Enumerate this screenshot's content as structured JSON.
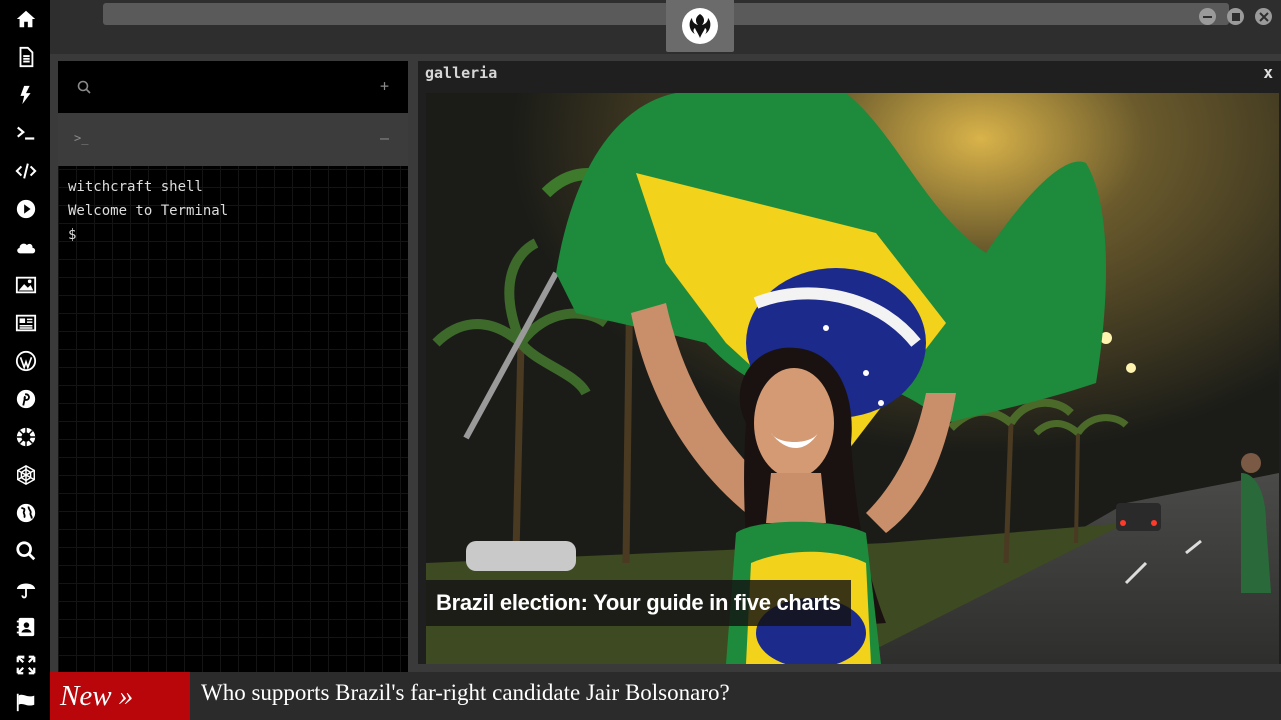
{
  "sidebar": {
    "icons": [
      "home-icon",
      "document-icon",
      "lightning-icon",
      "terminal-icon",
      "code-icon",
      "play-icon",
      "cloud-icon",
      "image-icon",
      "newspaper-icon",
      "wordpress-icon",
      "pinterest-icon",
      "rebel-alliance-icon",
      "galactic-empire-icon",
      "globe-icon",
      "search-icon",
      "umbrella-icon",
      "contact-book-icon",
      "expand-icon",
      "flag-icon"
    ]
  },
  "topbar": {
    "address_value": "",
    "window_buttons": [
      "minimize",
      "maximize",
      "close"
    ]
  },
  "terminal": {
    "search_add_label": "+",
    "tab_label": ">_",
    "tab_close_label": "–",
    "lines": [
      "witchcraft shell",
      "Welcome to Terminal",
      "$"
    ]
  },
  "gallery": {
    "title": "galleria",
    "close_label": "x",
    "caption": "Brazil election: Your guide in five charts"
  },
  "ticker": {
    "badge": "New »",
    "headline": "Who supports Brazil's far-right candidate Jair Bolsonaro?"
  },
  "colors": {
    "sidebar_bg": "#000000",
    "badge_red": "#b8060a",
    "flag_green": "#1e8a3c",
    "flag_yellow": "#f2d21a",
    "flag_blue": "#1c2a8c"
  }
}
